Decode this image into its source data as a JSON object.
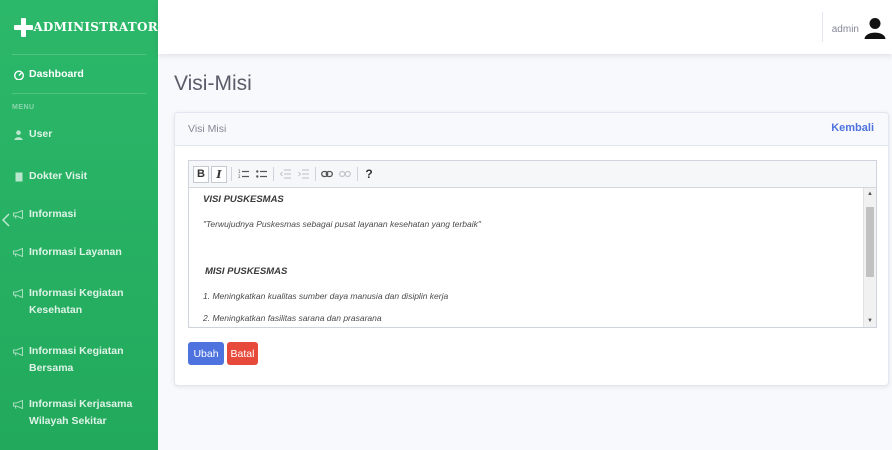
{
  "brand": {
    "title": "ADMINISTRATOR",
    "icon": "plus-icon"
  },
  "sidebar": {
    "dashboard": {
      "label": "Dashboard",
      "icon": "dashboard-icon"
    },
    "heading": "MENU",
    "items": [
      {
        "label": "User",
        "icon": "user-icon"
      },
      {
        "label": "Dokter Visit",
        "icon": "document-icon"
      },
      {
        "label": "Informasi",
        "icon": "megaphone-icon"
      },
      {
        "label": "Informasi Layanan",
        "icon": "megaphone-icon"
      },
      {
        "label": "Informasi Kegiatan Kesehatan",
        "icon": "megaphone-icon"
      },
      {
        "label": "Informasi Kegiatan Bersama",
        "icon": "megaphone-icon"
      },
      {
        "label": "Informasi Kerjasama Wilayah Sekitar",
        "icon": "megaphone-icon"
      }
    ]
  },
  "topbar": {
    "user_name": "admin",
    "avatar_icon": "user-avatar-icon"
  },
  "page": {
    "title": "Visi-Misi"
  },
  "card": {
    "title": "Visi Misi",
    "back_label": "Kembali"
  },
  "editor": {
    "toolbar": {
      "bold": "B",
      "italic": "I",
      "ordered_list": "1≡",
      "unordered_list": "•≡",
      "outdent": "⇤",
      "indent": "⇥",
      "link": "⚭",
      "unlink": "⛓",
      "help": "?"
    },
    "content": {
      "visi_heading": "VISI PUSKESMAS",
      "visi_text": "\"Terwujudnya Puskesmas sebagai pusat layanan kesehatan yang terbaik\"",
      "misi_heading": "MISI PUSKESMAS",
      "misi_items": [
        "1. Meningkatkan kualitas sumber daya manusia dan disiplin kerja",
        "2. Meningkatkan fasilitas sarana dan prasarana"
      ]
    }
  },
  "buttons": {
    "save": "Ubah",
    "cancel": "Batal"
  },
  "colors": {
    "sidebar": "#22a95c",
    "primary": "#4e73df",
    "danger": "#e74a3b",
    "text_muted": "#858796"
  }
}
